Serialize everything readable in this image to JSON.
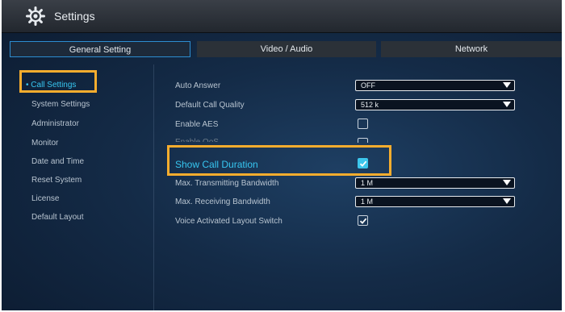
{
  "app": {
    "title": "Settings",
    "icon": "gear-icon"
  },
  "tabs": [
    {
      "label": "General Setting",
      "active": true
    },
    {
      "label": "Video / Audio",
      "active": false
    },
    {
      "label": "Network",
      "active": false
    }
  ],
  "sidebar": {
    "items": [
      {
        "label": "Call Settings",
        "active": true
      },
      {
        "label": "System Settings"
      },
      {
        "label": "Administrator"
      },
      {
        "label": "Monitor"
      },
      {
        "label": "Date and Time"
      },
      {
        "label": "Reset System"
      },
      {
        "label": "License"
      },
      {
        "label": "Default Layout"
      }
    ]
  },
  "settings": {
    "auto_answer": {
      "label": "Auto Answer",
      "value": "OFF"
    },
    "default_call_quality": {
      "label": "Default Call Quality",
      "value": "512 k"
    },
    "enable_aes": {
      "label": "Enable AES",
      "checked": false
    },
    "enable_qos": {
      "label": "Enable QoS",
      "checked": false
    },
    "show_call_duration": {
      "label": "Show Call Duration",
      "checked": true
    },
    "max_tx_bandwidth": {
      "label": "Max. Transmitting Bandwidth",
      "value": "1 M"
    },
    "max_rx_bandwidth": {
      "label": "Max. Receiving Bandwidth",
      "value": "1 M"
    },
    "voice_activated_layout_switch": {
      "label": "Voice Activated Layout Switch",
      "checked": true
    }
  },
  "colors": {
    "accent": "#37c6f1",
    "highlight_box": "#f7ad2e",
    "background": "#142b47"
  }
}
